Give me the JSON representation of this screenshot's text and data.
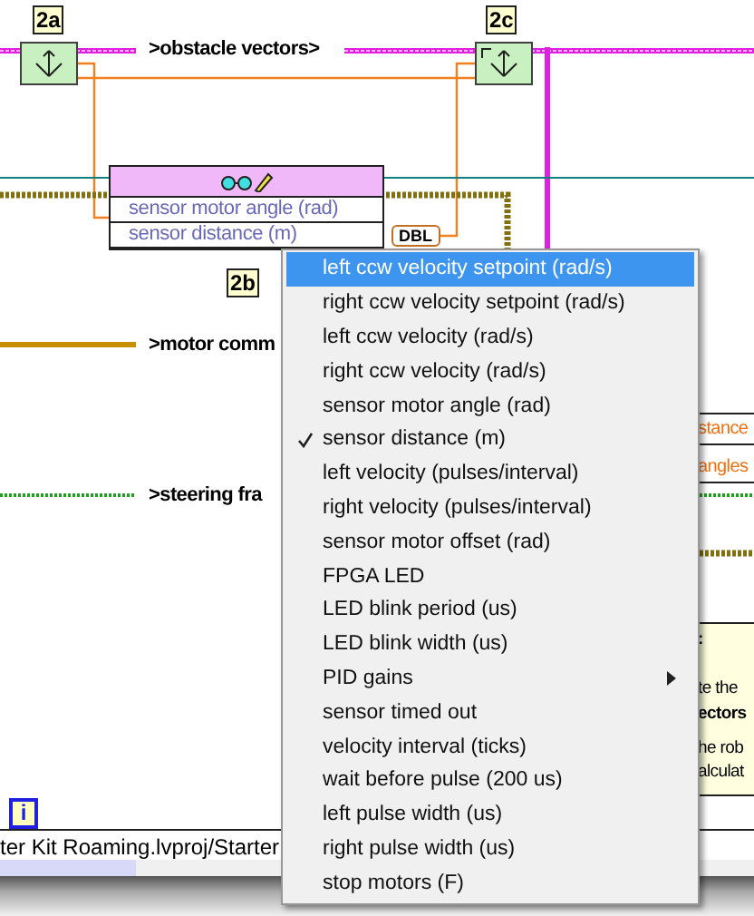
{
  "diagram": {
    "tunnel_labels": [
      "2a",
      "2c",
      "2b"
    ],
    "wire_labels": [
      ">obstacle vectors>",
      ">motor comm",
      ">steering fra"
    ],
    "unbundle": {
      "elements": [
        "sensor motor angle (rad)",
        "sensor distance (m)"
      ],
      "type_terminal": "DBL"
    },
    "output_labels": [
      "stance",
      "angles"
    ],
    "comment": [
      {
        "text": ":",
        "bold": true
      },
      {
        "text": "te the",
        "bold": false
      },
      {
        "text": "ectors",
        "bold": true
      },
      {
        "text": "he rob",
        "bold": false
      },
      {
        "text": "alculat",
        "bold": false
      }
    ]
  },
  "status_bar": {
    "info": "i",
    "path": "ter Kit Roaming.lvproj/Starter"
  },
  "context_menu": {
    "items": [
      {
        "label": "left ccw velocity setpoint (rad/s)",
        "selected": true,
        "checked": false,
        "kind": "item"
      },
      {
        "label": "right ccw velocity setpoint (rad/s)",
        "selected": false,
        "checked": false,
        "kind": "item"
      },
      {
        "label": "left ccw velocity (rad/s)",
        "selected": false,
        "checked": false,
        "kind": "item"
      },
      {
        "label": "right ccw velocity (rad/s)",
        "selected": false,
        "checked": false,
        "kind": "item"
      },
      {
        "label": "sensor motor angle (rad)",
        "selected": false,
        "checked": false,
        "kind": "item"
      },
      {
        "label": "sensor distance (m)",
        "selected": false,
        "checked": true,
        "kind": "item"
      },
      {
        "label": "left velocity (pulses/interval)",
        "selected": false,
        "checked": false,
        "kind": "item"
      },
      {
        "label": "right velocity (pulses/interval)",
        "selected": false,
        "checked": false,
        "kind": "item"
      },
      {
        "label": "sensor motor offset (rad)",
        "selected": false,
        "checked": false,
        "kind": "item"
      },
      {
        "label": "FPGA LED",
        "selected": false,
        "checked": false,
        "kind": "item"
      },
      {
        "label": "LED blink period (us)",
        "selected": false,
        "checked": false,
        "kind": "item"
      },
      {
        "label": "LED blink width (us)",
        "selected": false,
        "checked": false,
        "kind": "item"
      },
      {
        "label": "PID gains",
        "selected": false,
        "checked": false,
        "kind": "submenu"
      },
      {
        "label": "sensor timed out",
        "selected": false,
        "checked": false,
        "kind": "item"
      },
      {
        "label": "velocity interval (ticks)",
        "selected": false,
        "checked": false,
        "kind": "item"
      },
      {
        "label": "wait before pulse (200 us)",
        "selected": false,
        "checked": false,
        "kind": "item"
      },
      {
        "label": "left pulse width (us)",
        "selected": false,
        "checked": false,
        "kind": "item"
      },
      {
        "label": "right pulse width (us)",
        "selected": false,
        "checked": false,
        "kind": "item"
      },
      {
        "label": "stop motors (F)",
        "selected": false,
        "checked": false,
        "kind": "item"
      }
    ]
  }
}
